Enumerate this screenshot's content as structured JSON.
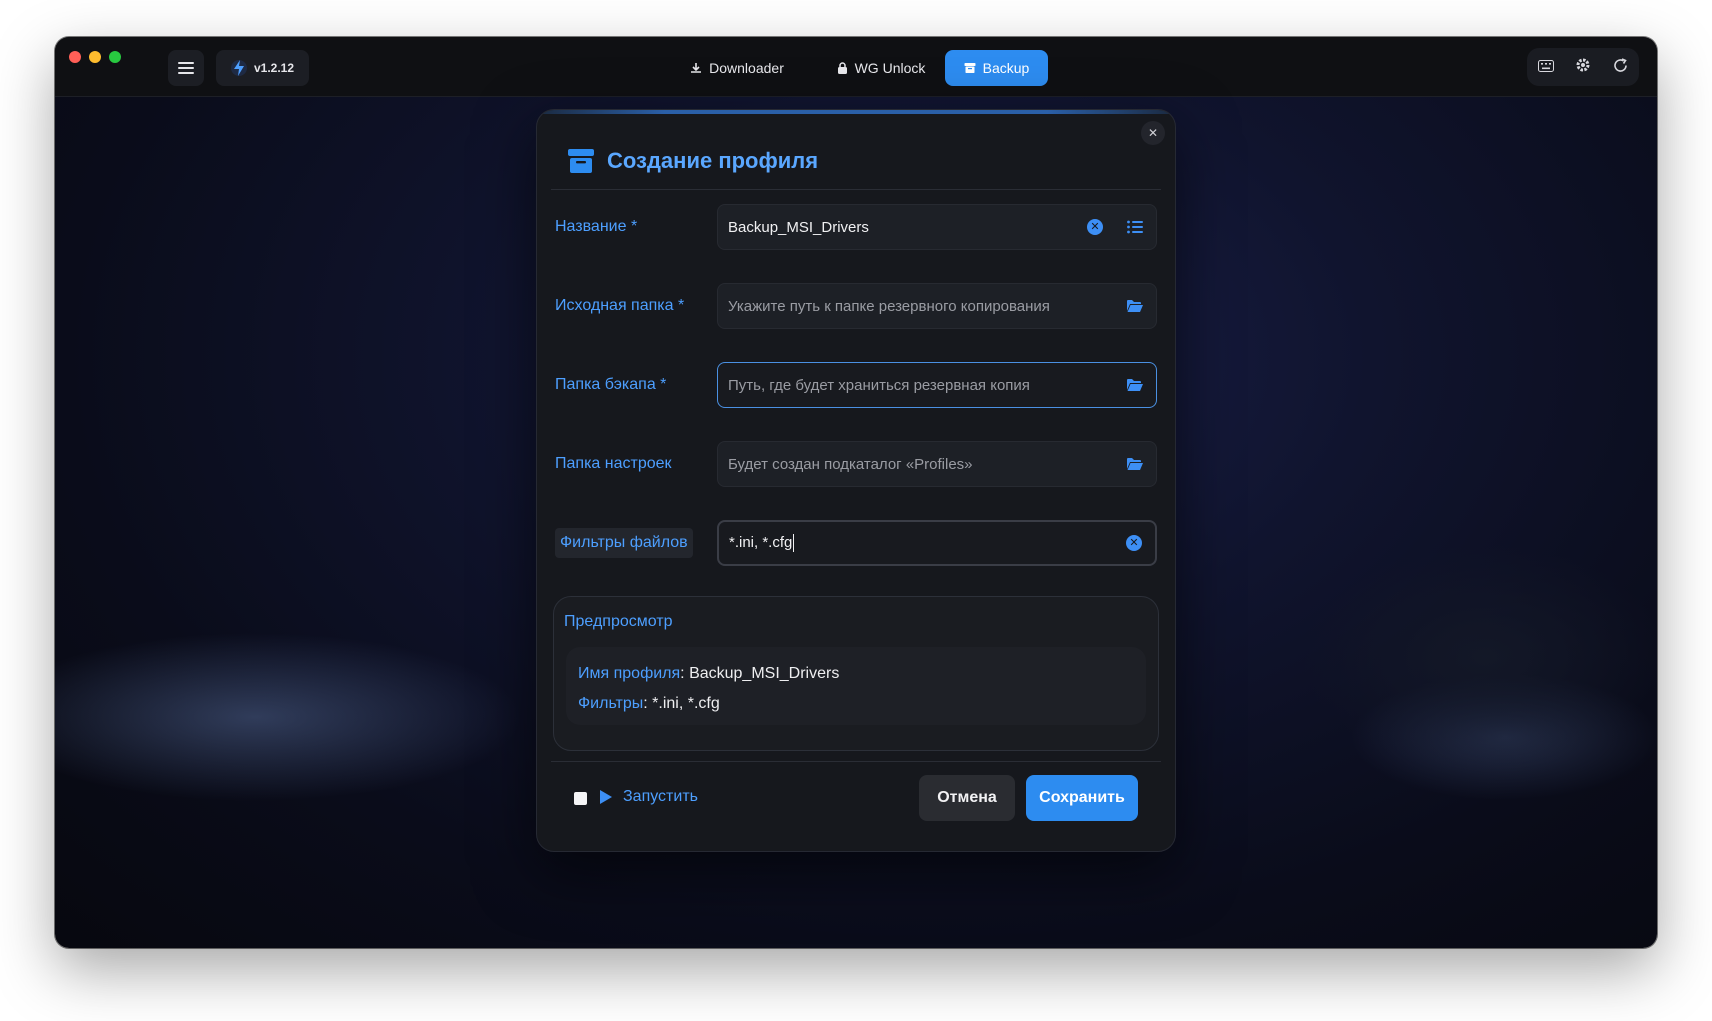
{
  "app": {
    "version": "v1.2.12"
  },
  "tabs": [
    {
      "label": "Downloader",
      "icon": "download-icon"
    },
    {
      "label": "WG Unlock",
      "icon": "lock-icon"
    },
    {
      "label": "Backup",
      "icon": "archive-icon",
      "active": true
    }
  ],
  "toolbar_right": [
    "keyboard-icon",
    "gear-icon",
    "refresh-icon"
  ],
  "modal": {
    "title": "Создание профиля",
    "fields": {
      "name": {
        "label": "Название *",
        "value": "Backup_MSI_Drivers"
      },
      "source": {
        "label": "Исходная папка *",
        "placeholder": "Укажите путь к папке резервного копирования"
      },
      "backup": {
        "label": "Папка бэкапа *",
        "placeholder": "Путь, где будет храниться резервная копия"
      },
      "settings": {
        "label": "Папка настроек",
        "placeholder": "Будет создан подкаталог «Profiles»"
      },
      "filters": {
        "label": "Фильтры файлов",
        "value": "*.ini, *.cfg"
      }
    },
    "preview": {
      "title": "Предпросмотр",
      "profile_key": "Имя профиля",
      "profile_value": ": Backup_MSI_Drivers",
      "filters_key": "Фильтры",
      "filters_value": ": *.ini, *.cfg"
    },
    "footer": {
      "run_label": "Запустить",
      "run_checked": false,
      "cancel_label": "Отмена",
      "save_label": "Сохранить"
    }
  },
  "colors": {
    "accent": "#2d8cf0",
    "label": "#4d9fff",
    "bg": "#16181d"
  }
}
